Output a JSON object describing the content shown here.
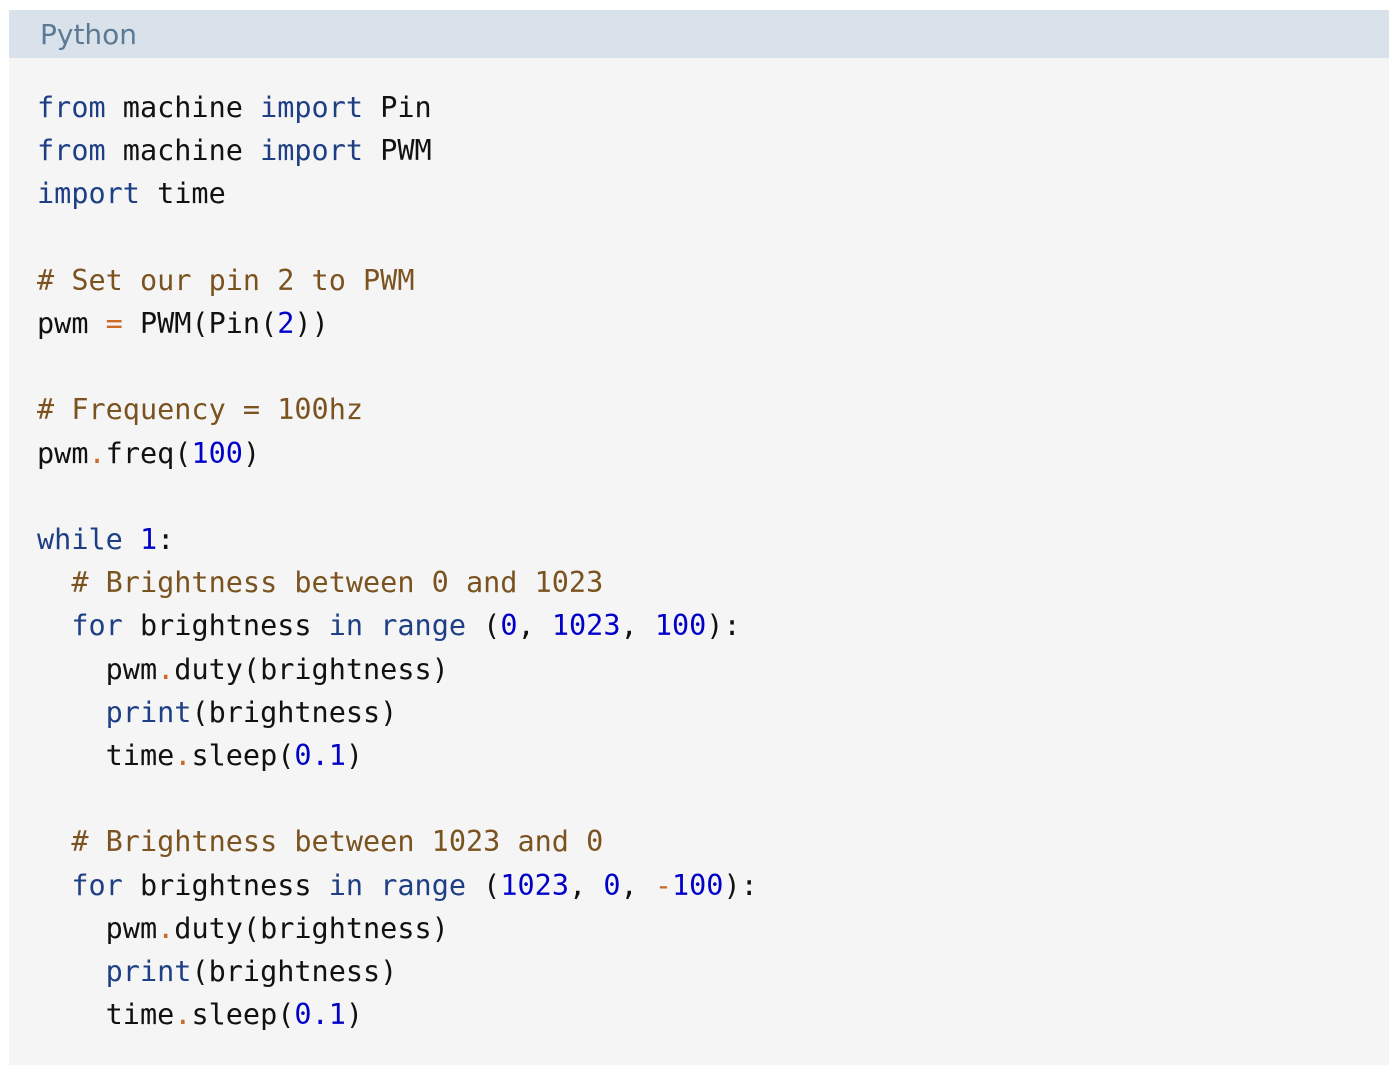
{
  "header": {
    "language": "Python"
  },
  "colors": {
    "keyword": "#1f3f85",
    "comment": "#7a5320",
    "number": "#0000c8",
    "operator": "#cd6a26",
    "text": "#111111",
    "header_bg": "#d9e2ea",
    "code_bg": "#f5f5f5"
  },
  "code": {
    "lines": [
      [
        {
          "t": "from",
          "c": "kw"
        },
        {
          "t": " machine ",
          "c": "plain"
        },
        {
          "t": "import",
          "c": "kw"
        },
        {
          "t": " Pin",
          "c": "plain"
        }
      ],
      [
        {
          "t": "from",
          "c": "kw"
        },
        {
          "t": " machine ",
          "c": "plain"
        },
        {
          "t": "import",
          "c": "kw"
        },
        {
          "t": " PWM",
          "c": "plain"
        }
      ],
      [
        {
          "t": "import",
          "c": "kw"
        },
        {
          "t": " time",
          "c": "plain"
        }
      ],
      [],
      [
        {
          "t": "# Set our pin 2 to PWM",
          "c": "cm"
        }
      ],
      [
        {
          "t": "pwm ",
          "c": "plain"
        },
        {
          "t": "=",
          "c": "op"
        },
        {
          "t": " PWM(Pin(",
          "c": "plain"
        },
        {
          "t": "2",
          "c": "num"
        },
        {
          "t": "))",
          "c": "plain"
        }
      ],
      [],
      [
        {
          "t": "# Frequency = 100hz",
          "c": "cm"
        }
      ],
      [
        {
          "t": "pwm",
          "c": "plain"
        },
        {
          "t": ".",
          "c": "op"
        },
        {
          "t": "freq(",
          "c": "plain"
        },
        {
          "t": "100",
          "c": "num"
        },
        {
          "t": ")",
          "c": "plain"
        }
      ],
      [],
      [
        {
          "t": "while",
          "c": "kw"
        },
        {
          "t": " ",
          "c": "plain"
        },
        {
          "t": "1",
          "c": "num"
        },
        {
          "t": ":",
          "c": "plain"
        }
      ],
      [
        {
          "t": "  ",
          "c": "plain"
        },
        {
          "t": "# Brightness between 0 and 1023",
          "c": "cm"
        }
      ],
      [
        {
          "t": "  ",
          "c": "plain"
        },
        {
          "t": "for",
          "c": "kw"
        },
        {
          "t": " brightness ",
          "c": "plain"
        },
        {
          "t": "in",
          "c": "kw"
        },
        {
          "t": " ",
          "c": "plain"
        },
        {
          "t": "range",
          "c": "kw"
        },
        {
          "t": " (",
          "c": "plain"
        },
        {
          "t": "0",
          "c": "num"
        },
        {
          "t": ", ",
          "c": "plain"
        },
        {
          "t": "1023",
          "c": "num"
        },
        {
          "t": ", ",
          "c": "plain"
        },
        {
          "t": "100",
          "c": "num"
        },
        {
          "t": "):",
          "c": "plain"
        }
      ],
      [
        {
          "t": "    pwm",
          "c": "plain"
        },
        {
          "t": ".",
          "c": "op"
        },
        {
          "t": "duty(brightness)",
          "c": "plain"
        }
      ],
      [
        {
          "t": "    ",
          "c": "plain"
        },
        {
          "t": "print",
          "c": "kw"
        },
        {
          "t": "(brightness)",
          "c": "plain"
        }
      ],
      [
        {
          "t": "    time",
          "c": "plain"
        },
        {
          "t": ".",
          "c": "op"
        },
        {
          "t": "sleep(",
          "c": "plain"
        },
        {
          "t": "0.1",
          "c": "num"
        },
        {
          "t": ")",
          "c": "plain"
        }
      ],
      [],
      [
        {
          "t": "  ",
          "c": "plain"
        },
        {
          "t": "# Brightness between 1023 and 0",
          "c": "cm"
        }
      ],
      [
        {
          "t": "  ",
          "c": "plain"
        },
        {
          "t": "for",
          "c": "kw"
        },
        {
          "t": " brightness ",
          "c": "plain"
        },
        {
          "t": "in",
          "c": "kw"
        },
        {
          "t": " ",
          "c": "plain"
        },
        {
          "t": "range",
          "c": "kw"
        },
        {
          "t": " (",
          "c": "plain"
        },
        {
          "t": "1023",
          "c": "num"
        },
        {
          "t": ", ",
          "c": "plain"
        },
        {
          "t": "0",
          "c": "num"
        },
        {
          "t": ", ",
          "c": "plain"
        },
        {
          "t": "-",
          "c": "op"
        },
        {
          "t": "100",
          "c": "num"
        },
        {
          "t": "):",
          "c": "plain"
        }
      ],
      [
        {
          "t": "    pwm",
          "c": "plain"
        },
        {
          "t": ".",
          "c": "op"
        },
        {
          "t": "duty(brightness)",
          "c": "plain"
        }
      ],
      [
        {
          "t": "    ",
          "c": "plain"
        },
        {
          "t": "print",
          "c": "kw"
        },
        {
          "t": "(brightness)",
          "c": "plain"
        }
      ],
      [
        {
          "t": "    time",
          "c": "plain"
        },
        {
          "t": ".",
          "c": "op"
        },
        {
          "t": "sleep(",
          "c": "plain"
        },
        {
          "t": "0.1",
          "c": "num"
        },
        {
          "t": ")",
          "c": "plain"
        }
      ]
    ]
  }
}
